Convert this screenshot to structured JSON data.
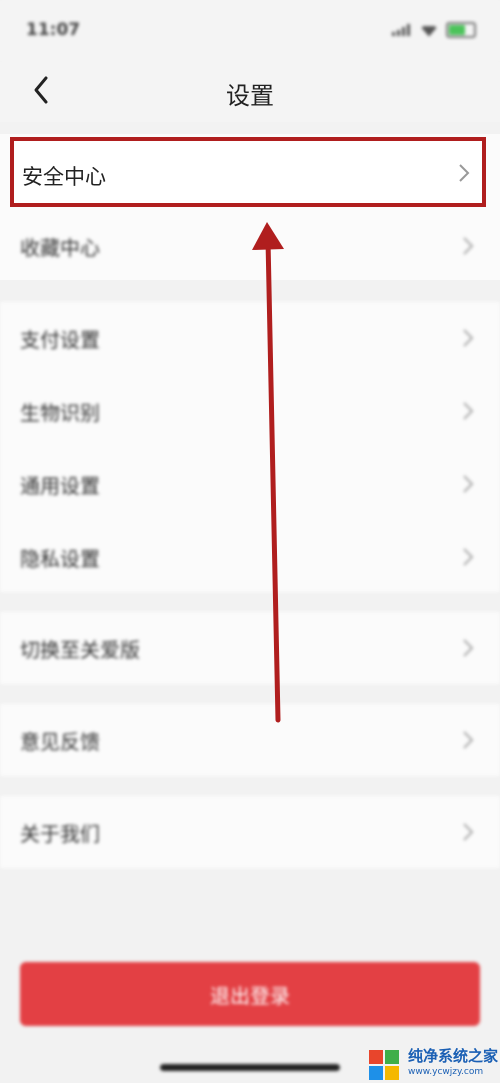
{
  "status_bar": {
    "time": "11:07"
  },
  "nav": {
    "title": "设置",
    "back_icon": "chevron-left-icon"
  },
  "highlighted_item": {
    "label": "安全中心"
  },
  "groups": [
    {
      "items": [
        {
          "label": "收藏中心"
        }
      ]
    },
    {
      "items": [
        {
          "label": "支付设置"
        },
        {
          "label": "生物识别"
        },
        {
          "label": "通用设置"
        },
        {
          "label": "隐私设置"
        }
      ]
    },
    {
      "items": [
        {
          "label": "切换至关爱版"
        }
      ]
    },
    {
      "items": [
        {
          "label": "意见反馈"
        }
      ]
    },
    {
      "items": [
        {
          "label": "关于我们"
        }
      ]
    }
  ],
  "logout_button": {
    "label": "退出登录"
  },
  "watermark": {
    "name": "纯净系统之家",
    "url": "www.ycwjzy.com"
  },
  "colors": {
    "highlight": "#b01e1e",
    "arrow": "#b01e1e",
    "logout": "#e34044"
  }
}
